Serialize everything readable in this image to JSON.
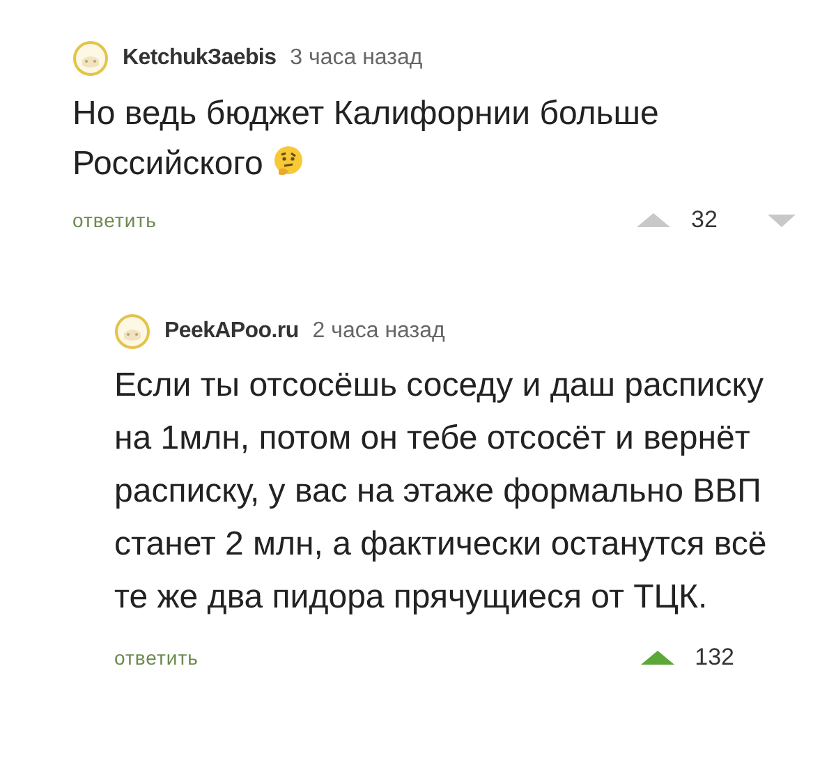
{
  "comments": [
    {
      "author": "KetchukЗaebis",
      "time": "3 часа назад",
      "text": "Но ведь бюджет Калифорнии больше Российского",
      "trailing_emoji": true,
      "reply": "ответить",
      "score": "32",
      "upvoted": false,
      "show_downvote": true,
      "children": [
        {
          "author": "PeekAPoo.ru",
          "time": "2 часа назад",
          "text": "Если ты отсосёшь соседу и даш расписку на 1млн, потом он тебе отсосёт и вернёт расписку, у вас на этаже формально ВВП станет 2 млн, а фактически останутся всё те же два пидора прячущиеся от ТЦК.",
          "trailing_emoji": false,
          "reply": "ответить",
          "score": "132",
          "upvoted": true,
          "show_downvote": false
        }
      ]
    }
  ]
}
